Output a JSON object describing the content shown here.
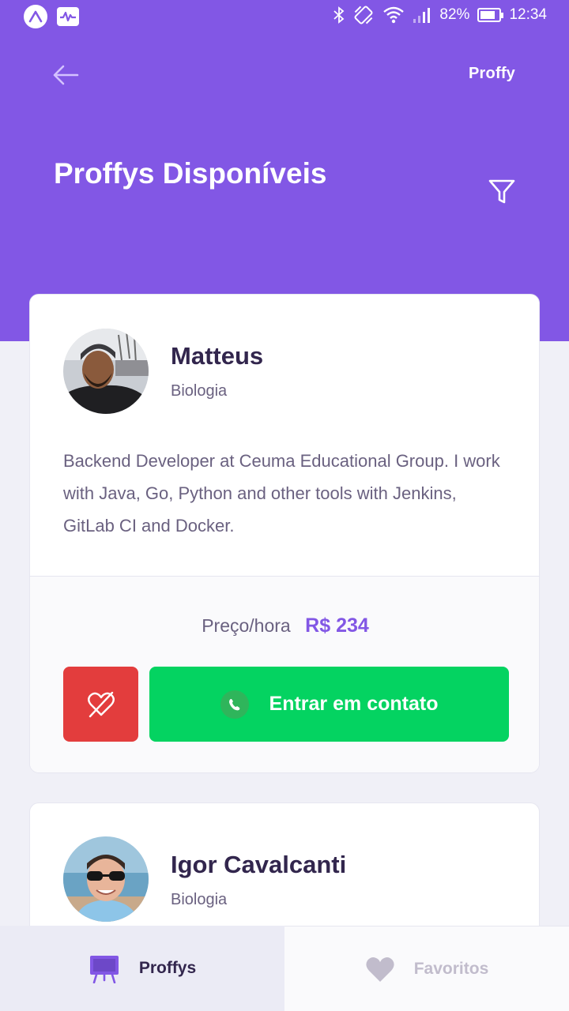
{
  "status_bar": {
    "battery": "82%",
    "battery_level": 0.82,
    "time": "12:34"
  },
  "header": {
    "brand": "Proffy",
    "title": "Proffys Disponíveis"
  },
  "teachers": [
    {
      "name": "Matteus",
      "subject": "Biologia",
      "bio": "Backend Developer at Ceuma Educational Group. I work with Java, Go, Python and other tools with Jenkins, GitLab CI and Docker.",
      "price_label": "Preço/hora",
      "price_value": "R$ 234",
      "contact_label": "Entrar em contato"
    },
    {
      "name": "Igor Cavalcanti",
      "subject": "Biologia"
    }
  ],
  "tabs": [
    {
      "label": "Proffys",
      "active": true
    },
    {
      "label": "Favoritos",
      "active": false
    }
  ],
  "colors": {
    "primary": "#8257e5",
    "danger": "#e33d3d",
    "success": "#04d361",
    "title_text": "#32264d",
    "body_text": "#6a6180",
    "background": "#f0f0f7"
  }
}
